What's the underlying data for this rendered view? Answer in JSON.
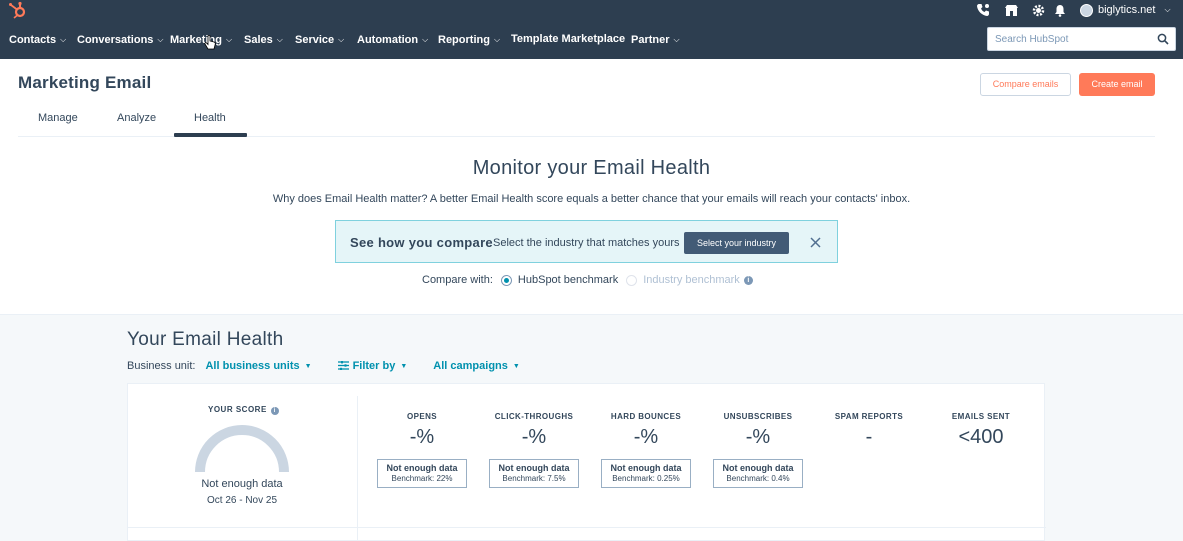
{
  "topbar": {
    "account_name": "biglytics.net",
    "icons": [
      "hubspot-logo-icon",
      "phone-icon",
      "marketplace-icon",
      "gear-icon",
      "bell-icon"
    ]
  },
  "nav": {
    "items": [
      {
        "label": "Contacts"
      },
      {
        "label": "Conversations"
      },
      {
        "label": "Marketing"
      },
      {
        "label": "Sales"
      },
      {
        "label": "Service"
      },
      {
        "label": "Automation"
      },
      {
        "label": "Reporting"
      },
      {
        "label": "Template Marketplace"
      },
      {
        "label": "Partner"
      }
    ],
    "search_placeholder": "Search HubSpot"
  },
  "header": {
    "title": "Marketing Email",
    "compare_button": "Compare emails",
    "create_button": "Create email"
  },
  "tabs": [
    {
      "label": "Manage"
    },
    {
      "label": "Analyze"
    },
    {
      "label": "Health",
      "active": true
    }
  ],
  "monitor": {
    "title": "Monitor your Email Health",
    "description": "Why does Email Health matter? A better Email Health score equals a better chance that your emails will reach your contacts' inbox.",
    "compare_box": {
      "headline": "See how you compare",
      "subtext": "Select the industry that matches yours",
      "button": "Select your industry"
    },
    "compare_with": {
      "label": "Compare with:",
      "options": [
        {
          "label": "HubSpot benchmark",
          "selected": true
        },
        {
          "label": "Industry benchmark",
          "selected": false
        }
      ]
    }
  },
  "health": {
    "title": "Your Email Health",
    "business_unit_label": "Business unit:",
    "business_unit_value": "All business units",
    "filter_label": "Filter by",
    "campaigns_label": "All campaigns",
    "score": {
      "label": "YOUR SCORE",
      "status": "Not enough data",
      "date_range": "Oct 26 - Nov 25"
    },
    "metrics": [
      {
        "label": "OPENS",
        "value": "-%",
        "bench_status": "Not enough data",
        "benchmark": "Benchmark: 22%"
      },
      {
        "label": "CLICK-THROUGHS",
        "value": "-%",
        "bench_status": "Not enough data",
        "benchmark": "Benchmark: 7.5%"
      },
      {
        "label": "HARD BOUNCES",
        "value": "-%",
        "bench_status": "Not enough data",
        "benchmark": "Benchmark: 0.25%"
      },
      {
        "label": "UNSUBSCRIBES",
        "value": "-%",
        "bench_status": "Not enough data",
        "benchmark": "Benchmark: 0.4%"
      },
      {
        "label": "SPAM REPORTS",
        "value": "-"
      },
      {
        "label": "EMAILS SENT",
        "value": "<400"
      }
    ]
  },
  "colors": {
    "nav_bg": "#2d3e50",
    "accent_orange": "#ff7a59",
    "link_teal": "#0091ae",
    "info_box_bg": "#e5f5f8"
  }
}
